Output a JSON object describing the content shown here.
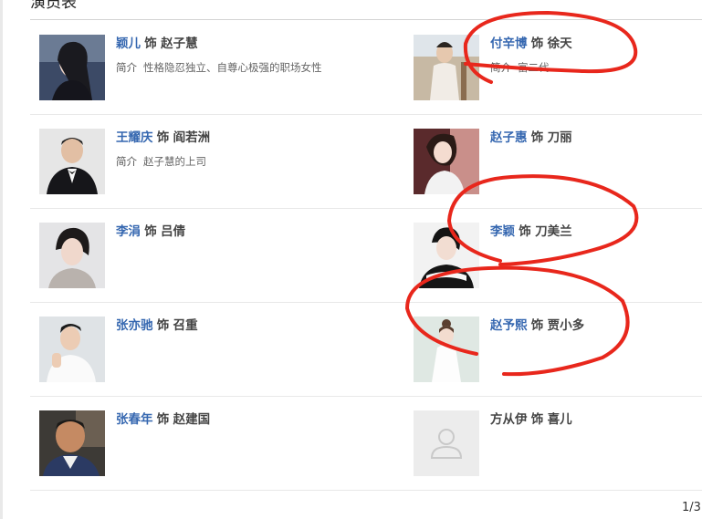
{
  "section": {
    "title": "演员表"
  },
  "role_joiner": "饰",
  "intro_label": "简介",
  "cast": [
    {
      "actor": "颖儿",
      "role": "赵子慧",
      "intro": "性格隐忍独立、自尊心极强的职场女性"
    },
    {
      "actor": "付辛博",
      "role": "徐天",
      "intro": "富二代"
    },
    {
      "actor": "王耀庆",
      "role": "阎若洲",
      "intro": "赵子慧的上司"
    },
    {
      "actor": "赵子惠",
      "role": "刀丽",
      "intro": ""
    },
    {
      "actor": "李涓",
      "role": "吕倩",
      "intro": ""
    },
    {
      "actor": "李颖",
      "role": "刀美兰",
      "intro": ""
    },
    {
      "actor": "张亦驰",
      "role": "召重",
      "intro": ""
    },
    {
      "actor": "赵予熙",
      "role": "贾小多",
      "intro": ""
    },
    {
      "actor": "张春年",
      "role": "赵建国",
      "intro": ""
    },
    {
      "actor": "方从伊",
      "role": "喜儿",
      "intro": ""
    }
  ],
  "pagination": {
    "text": "1/3"
  },
  "annotation": {
    "color": "#e8271c"
  }
}
